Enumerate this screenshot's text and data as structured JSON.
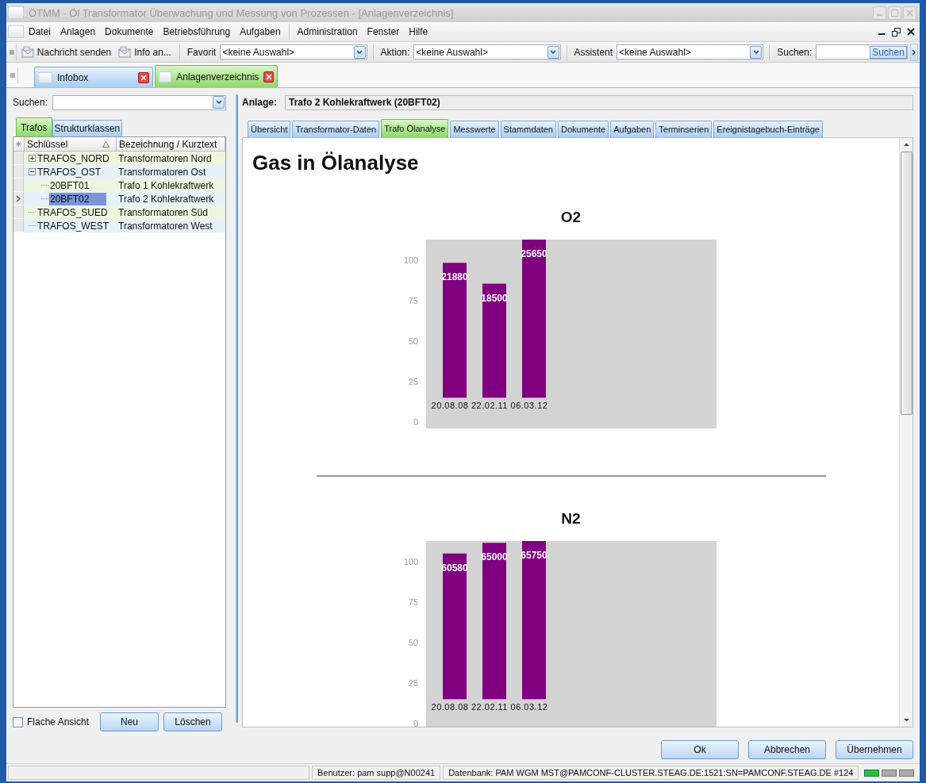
{
  "window": {
    "title": "ÖTMM - Öl Transformator Überwachung und Messung von Prozessen - [Anlagenverzeichnis]"
  },
  "menu_groups": [
    [
      "Datei",
      "Anlagen",
      "Dokumente",
      "Betriebsführung",
      "Aufgaben"
    ],
    [
      "Administration",
      "Fenster",
      "Hilfe"
    ]
  ],
  "toolbar": {
    "buttons": [
      "Nachricht senden",
      "Info an..."
    ],
    "combos": [
      {
        "label": "Favorit",
        "value": "<keine Auswahl>"
      },
      {
        "label": "Aktion:",
        "value": "<keine Auswahl>"
      },
      {
        "label": "Assistent",
        "value": "<keine Auswahl>"
      }
    ],
    "search": {
      "label": "Suchen:",
      "button": "Suchen"
    }
  },
  "doc_tabs": [
    {
      "label": "Infobox",
      "selected": false
    },
    {
      "label": "Anlagenverzeichnis",
      "selected": true
    }
  ],
  "left": {
    "search_label": "Suchen:",
    "tabs": [
      {
        "label": "Trafos",
        "selected": true
      },
      {
        "label": "Strukturklassen",
        "selected": false
      }
    ],
    "columns": [
      "Schlüssel",
      "Bezeichnung / Kurztext"
    ],
    "rows": [
      {
        "key": "TRAFOS_NORD",
        "text": "Transformatoren Nord",
        "expanded": false,
        "selected": false
      },
      {
        "key": "TRAFOS_OST",
        "text": "Transformatoren Ost",
        "expanded": true,
        "selected": false,
        "children": [
          {
            "key": "20BFT01",
            "text": "Trafo 1 Kohlekraftwerk",
            "selected": false
          },
          {
            "key": "20BFT02",
            "text": "Trafo 2 Kohlekraftwerk",
            "selected": true
          }
        ]
      },
      {
        "key": "TRAFOS_SUED",
        "text": "Transformatoren Süd",
        "selected": false
      },
      {
        "key": "TRAFOS_WEST",
        "text": "Transformatoren West",
        "selected": false
      }
    ],
    "flat_view": {
      "label": "Flache Ansicht",
      "checked": false
    },
    "buttons": [
      "Neu",
      "Löschen"
    ]
  },
  "right": {
    "anlage_label": "Anlage:",
    "anlage_value": "Trafo 2 Kohlekraftwerk (20BFT02)",
    "tabs": [
      {
        "label": "Übersicht",
        "selected": false
      },
      {
        "label": "Transformator-Daten",
        "selected": false
      },
      {
        "label": "Trafo Ölanalyse",
        "selected": true
      },
      {
        "label": "Messwerte",
        "selected": false
      },
      {
        "label": "Stammdaten",
        "selected": false
      },
      {
        "label": "Dokumente",
        "selected": false
      },
      {
        "label": "Aufgaben",
        "selected": false
      },
      {
        "label": "Terminserien",
        "selected": false
      },
      {
        "label": "Ereignistagebuch-Einträge",
        "selected": false
      }
    ],
    "heading": "Gas in Ölanalyse",
    "charts": [
      {
        "title": "O2",
        "axis_labels": [
          "100",
          "75",
          "50",
          "25",
          "0"
        ],
        "chart_data": {
          "type": "bar",
          "categories": [
            "20.08.08",
            "22.02.11",
            "06.03.12"
          ],
          "values": [
            21880,
            18500,
            25650
          ],
          "data_labels": true
        }
      },
      {
        "title": "N2",
        "axis_labels": [
          "100",
          "75",
          "50",
          "25",
          "0"
        ],
        "chart_data": {
          "type": "bar",
          "categories": [
            "20.08.08",
            "22.02.11",
            "06.03.12"
          ],
          "values": [
            60580,
            65000,
            65750
          ],
          "data_labels": true
        }
      }
    ]
  },
  "dialog_buttons": [
    "Ok",
    "Abbrechen",
    "Übernehmen"
  ],
  "status_bar": {
    "cells": [
      "Benutzer: pam  supp@N00241",
      "Datenbank: PAM  WGM  MST@PAMCONF-CLUSTER.STEAG.DE:1521:SN=PAMCONF.STEAG.DE #124"
    ],
    "leds": [
      {
        "on": true
      },
      {
        "on": false
      },
      {
        "on": false
      }
    ]
  }
}
